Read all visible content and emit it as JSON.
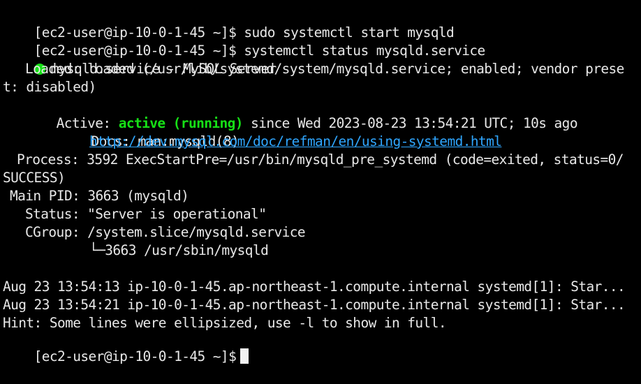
{
  "terminal": {
    "top_fragment": "",
    "prompt": "[ec2-user@ip-10-0-1-45 ~]$",
    "cmd1": "sudo systemctl start mysqld",
    "cmd2": "systemctl status mysqld.service",
    "service_title": "mysqld.service - MySQL Server",
    "loaded_line1": "Loaded: loaded (/usr/lib/systemd/system/mysqld.service; enabled; vendor prese",
    "loaded_line2": "t: disabled)",
    "active_label": "Active:",
    "active_state": "active (running)",
    "active_rest": " since Wed 2023-08-23 13:54:21 UTC; 10s ago",
    "docs_label": "Docs:",
    "docs_value": "man:mysqld(8)",
    "docs_link": "http://dev.mysql.com/doc/refman/en/using-systemd.html",
    "process_line1": "Process: 3592 ExecStartPre=/usr/bin/mysqld_pre_systemd (code=exited, status=0/",
    "process_line2": "SUCCESS)",
    "main_pid": "Main PID: 3663 (mysqld)",
    "status": "Status: \"Server is operational\"",
    "cgroup": "CGroup: /system.slice/mysqld.service",
    "cgroup_child": "└─3663 /usr/sbin/mysqld",
    "log1": "Aug 23 13:54:13 ip-10-0-1-45.ap-northeast-1.compute.internal systemd[1]: Star...",
    "log2": "Aug 23 13:54:21 ip-10-0-1-45.ap-northeast-1.compute.internal systemd[1]: Star...",
    "hint": "Hint: Some lines were ellipsized, use -l to show in full."
  },
  "colors": {
    "status_green": "#16e016",
    "link_blue": "#2fa6ff"
  }
}
